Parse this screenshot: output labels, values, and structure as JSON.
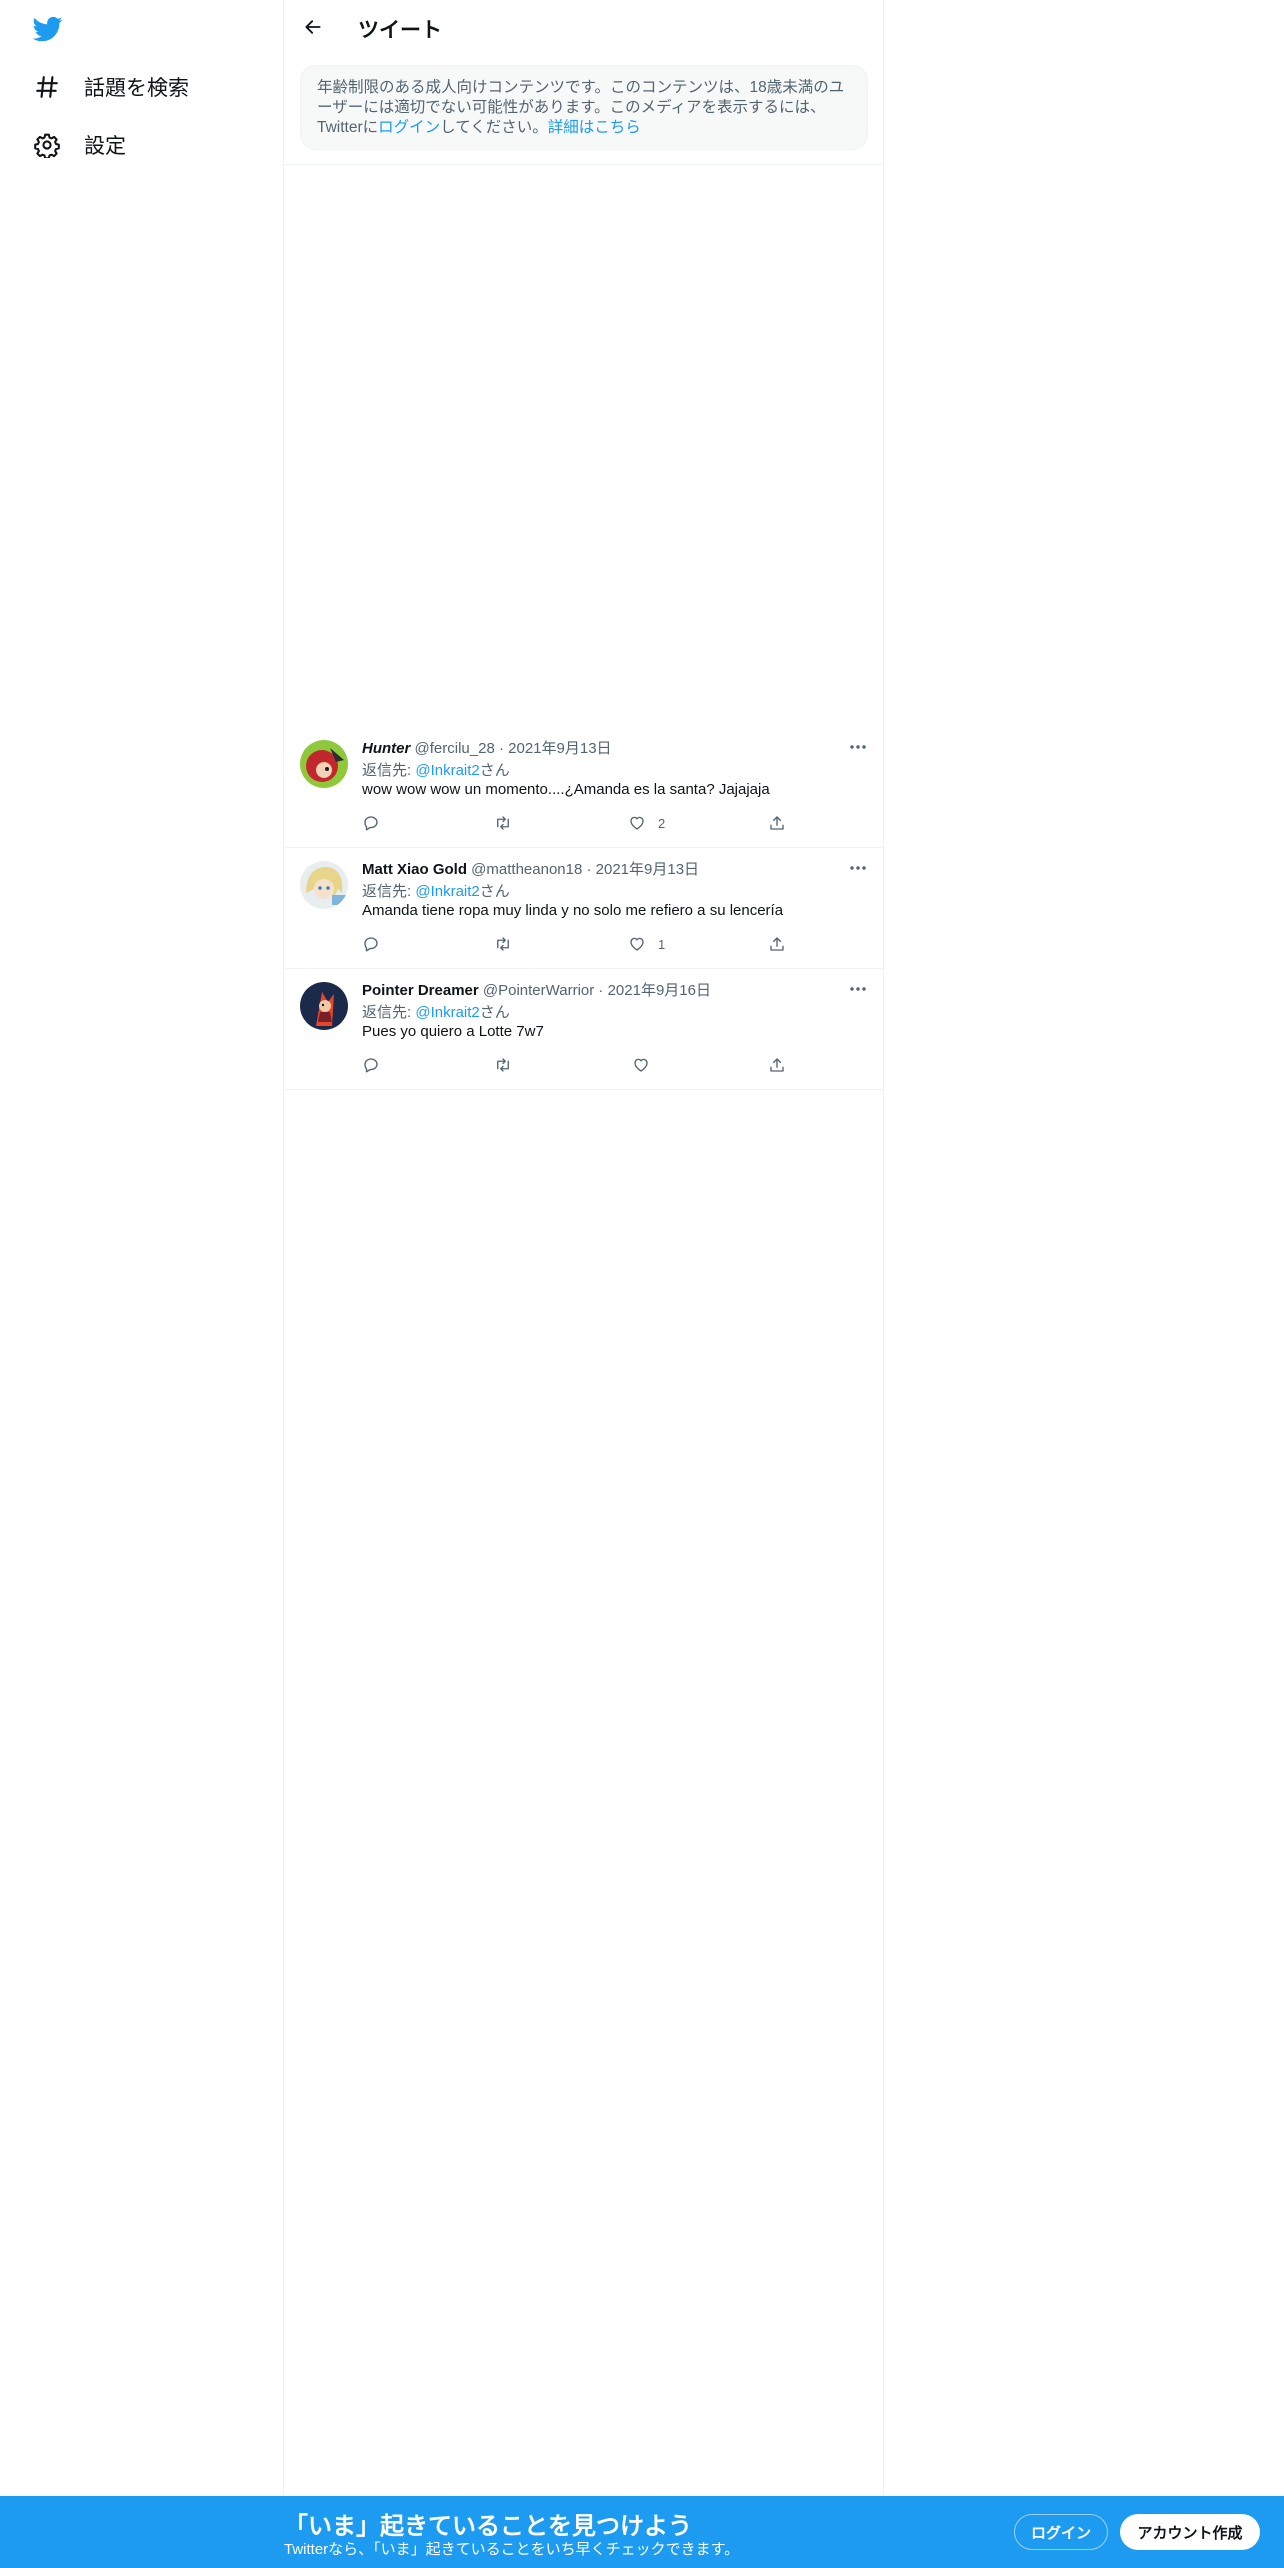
{
  "sidebar": {
    "items": [
      {
        "label": "話題を検索",
        "icon": "hashtag-icon"
      },
      {
        "label": "設定",
        "icon": "gear-icon"
      }
    ]
  },
  "header": {
    "title": "ツイート"
  },
  "notice": {
    "text_1": "年齢制限のある成人向けコンテンツです。このコンテンツは、18歳未満のユーザーには適切でない可能性があります。このメディアを表示するには、Twitterに",
    "login_link": "ログイン",
    "text_2": "してください。",
    "more_link": "詳細はこちら"
  },
  "tweets": [
    {
      "name": "Hunter",
      "handle": "@fercilu_28",
      "dot": "·",
      "date": "2021年9月13日",
      "reply_label": "返信先: ",
      "reply_mention": "@Inkrait2",
      "reply_suffix": "さん",
      "text": "wow wow wow un momento....¿Amanda es la santa? Jajajaja",
      "like_count": "2"
    },
    {
      "name": "Matt Xiao Gold",
      "handle": "@mattheanon18",
      "dot": "·",
      "date": "2021年9月13日",
      "reply_label": "返信先: ",
      "reply_mention": "@Inkrait2",
      "reply_suffix": "さん",
      "text": "Amanda tiene ropa muy linda y no solo me refiero a su lencería",
      "like_count": "1"
    },
    {
      "name": "Pointer Dreamer",
      "handle": "@PointerWarrior",
      "dot": "·",
      "date": "2021年9月16日",
      "reply_label": "返信先: ",
      "reply_mention": "@Inkrait2",
      "reply_suffix": "さん",
      "text": "Pues yo quiero a Lotte 7w7",
      "like_count": ""
    }
  ],
  "bottom_bar": {
    "title": "「いま」起きていることを見つけよう",
    "subtitle": "Twitterなら、「いま」起きていることをいち早くチェックできます。",
    "login_label": "ログイン",
    "signup_label": "アカウント作成"
  },
  "colors": {
    "accent": "#1d9bf0",
    "text": "#0f1419",
    "secondary_text": "#536471",
    "border": "#eff3f4"
  }
}
